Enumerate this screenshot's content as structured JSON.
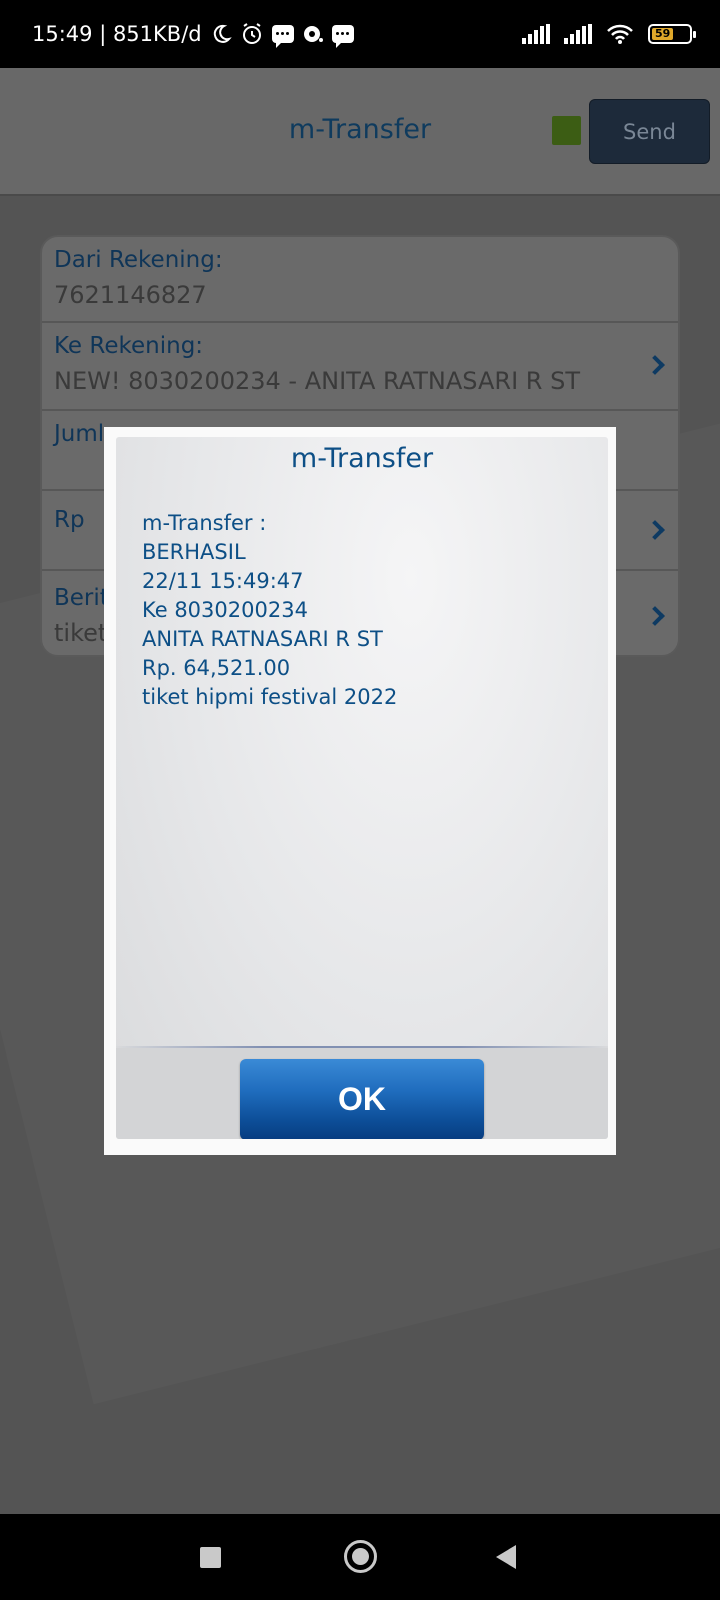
{
  "status_bar": {
    "time_speed": "15:49 | 851KB/d",
    "battery_level": "59"
  },
  "app": {
    "title": "m-Transfer",
    "send_label": "Send",
    "status_color": "#3c5d14",
    "form": {
      "from_account_label": "Dari Rekening:",
      "from_account_value": "7621146827",
      "to_account_label": "Ke Rekening:",
      "to_account_value": "NEW! 8030200234 - ANITA RATNASARI R ST",
      "amount_label": "Juml",
      "currency_label": "Rp",
      "message_label": "Berit",
      "message_value": "tiket"
    }
  },
  "dialog": {
    "title": "m-Transfer",
    "lines": [
      "m-Transfer :",
      "BERHASIL",
      "22/11 15:49:47",
      "Ke 8030200234",
      "ANITA RATNASARI R ST",
      "Rp. 64,521.00",
      "tiket hipmi festival 2022"
    ],
    "ok_label": "OK"
  },
  "colors": {
    "accent": "#0d4f86",
    "ok_button": "#1f6cbd"
  }
}
